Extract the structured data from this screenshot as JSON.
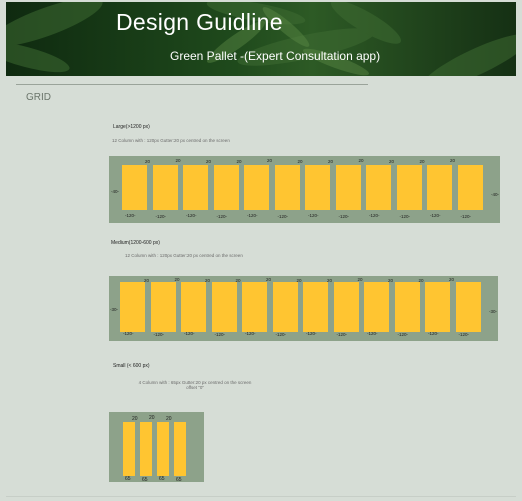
{
  "header": {
    "title": "Design Guidline",
    "subtitle": "Green Pallet -(Expert Consultation app)"
  },
  "section_title": "GRID",
  "colors": {
    "column": "#ffc531",
    "grid_background": "#8da28a",
    "page": "#d6ddd6"
  },
  "grids": [
    {
      "label": "Large(>1200 px)",
      "description": "12 Column with : 120px  Gutter:20 px centred on the screen",
      "margin_left": "-40-",
      "margin_right": "-40-",
      "column_count": 12,
      "column_width_label": "-120-",
      "gutter_label": "20"
    },
    {
      "label": "Medium(1200-600 px)",
      "description": "12 Column with : 120px  Gutter:20 px centred on the screen",
      "margin_left": "-30-",
      "margin_right": "-30-",
      "column_count": 12,
      "column_width_label": "-120-",
      "gutter_label": "20"
    },
    {
      "label": "Small (< 600 px)",
      "description_line1": "4 Column with : 65px  Gutter:20 px centred on the screen",
      "description_line2": "offset \"0\"",
      "column_count": 4,
      "column_width_label": "65",
      "gutter_label": "20"
    }
  ]
}
